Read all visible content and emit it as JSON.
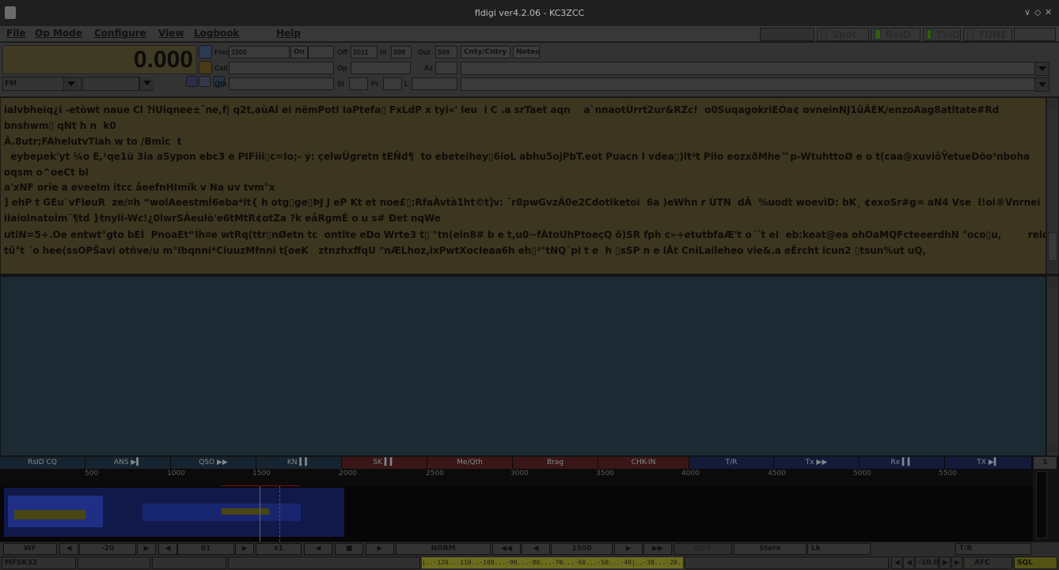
{
  "window": {
    "title": "fldigi ver4.2.06 - KC3ZCC",
    "controls": [
      "∨",
      "◇",
      "✕"
    ]
  },
  "menu": {
    "items": [
      "File",
      "Op Mode",
      "Configure",
      "View",
      "Logbook",
      "Help"
    ],
    "toggles": {
      "spot": "Spot",
      "rxid": "RxID",
      "txid": "TxID",
      "tune": "TUNE"
    }
  },
  "log": {
    "frequency_display": "0.000",
    "freq_label": "Freq",
    "freq_value": "1500",
    "on_label": "On",
    "off_label": "Off",
    "off_value": "2011",
    "in_label": "In",
    "in_value": "599",
    "out_label": "Out",
    "out_value": "599",
    "cnty_button": "Cnty/Cntry",
    "notes_button": "Notes",
    "call_label": "Call",
    "qth_label": "Qth",
    "op_label": "Op",
    "az_label": "Az",
    "st_label": "St",
    "pr_label": "Pr",
    "l_label": "L",
    "mode_combo": "FM"
  },
  "rx_lines": [
    "ialvbheiq¿i -etòwt naue Cl ?iUiqnee±¯ne,f| q2t,aùAl ei nëmPotl IaPtefa▯ FxLdP x tyi«' leu  i C .a srTaet aqn    a`nnaotÚrrt2ur&RZc!  o0SuqagokriEÓa¢ ovneinNJ1ûÂÈK/enzoAag8atltate#Rd",
    "bnshwm▯ qNt h n  k0",
    "Â.8utr;FÀhelutvTiah w to /Bmic  t",
    "  eybeµek'yt ¼o E,¹qe1ù 3ia aSypon ebc3 e PIFiii▯c=Io;- ý: çelwÛgretn tEÑd¶  to ebeteihey▯6ioL abhu5ojPbT.eot Puacn I vdea▯)lt²t Pilo eozxðMhe™p-WtuhttoØ e o t(caa@xuviôŸetueDöo³nboha",
    "oqsm o^oeCt bl",
    "a'xNF orie a eveeIm itcc åeefnHImïk v Na uv tvm°x",
    "] ehP t GEu`vFløuR  ze/¤h “wolAeestmÍ6eba*it{ h otg▯ge▯ÞJ J eP Kt et noe£▯:RfaÀvtà1ht©t]v: ¯r8pwGvzÁ0e2CdotIketoi  6a )eWhn r ÙTN  dÂ  %uodt woeviD: bK¸ ¢exoSr#g= aN4 Vse  I!oi®Vnrnei",
    "iiaioInatoim¨¶td }tnyli-Wc!¿0lwrSÁeulò'e6tMtR¢otZa ?k eåRgmÉ o u s# Ðet nqWe",
    "utiN=5+.Oe entwt°gto bEÌ  PnoaEt“Íh¤e wtRq(ttr▯nØetn tc  ontite eDo Wrte3 t▯ °tn(ein8# b e t,u0~fÀtoUhPtoeçQ ô)SR fph c»÷etutbfaÆ't o´¯t eI  eb:keat@ea ohOaMQFcteeerdhN °oco▯u,        relcqe",
    "tû°t ´o hee(ssOPŠavi otñve/u m°Ibqnni*CiuuzMfnni t[oeK   ztnzhxffqU \"nÆLhoz,ixPwtXocIeaa6h eh▯²°tNQ¯pi t e  h ▯sSP n e lÅt CniLaileheo vie&.a eÊrcht icun2 ▯tsun%ut uQ,"
  ],
  "macros": [
    "RsID CQ",
    "ANS ▶▍",
    "QSO ▶▶",
    "KN ▍▍",
    "SK ▍▍",
    "Me/Qth",
    "Brag",
    "CHK-IN",
    "T/R",
    "Tx ▶▶",
    "Rx ▍▍",
    "TX ▶▍"
  ],
  "macro_set": "1",
  "scale_ticks": [
    "500",
    "1000",
    "1500",
    "2000",
    "2500",
    "3000",
    "3500",
    "4000",
    "4500",
    "5000",
    "5500"
  ],
  "controls": {
    "wf_button": "WF",
    "level_low": "-20",
    "level_high": "81",
    "zoom": "x1",
    "norm": "NORM",
    "carrier": "1500",
    "qsy": "QSY",
    "store": "Store",
    "lk": "Lk",
    "tr": "T/R"
  },
  "status": {
    "mode": "MFSK32",
    "meter_scale": "|..-120..-110..-100...-90...-80...-70...-60...-50...-40|..-30...-20...-10...|",
    "squelch_value": "-10.0",
    "afc": "AFC",
    "sql": "SQL"
  },
  "colors": {
    "rx_bg": "#3c3520",
    "tx_bg": "#1b2a33",
    "meter": "#6c6c1f",
    "active_led": "#2e5f12",
    "waterfall_signal": "#1f2f86"
  }
}
